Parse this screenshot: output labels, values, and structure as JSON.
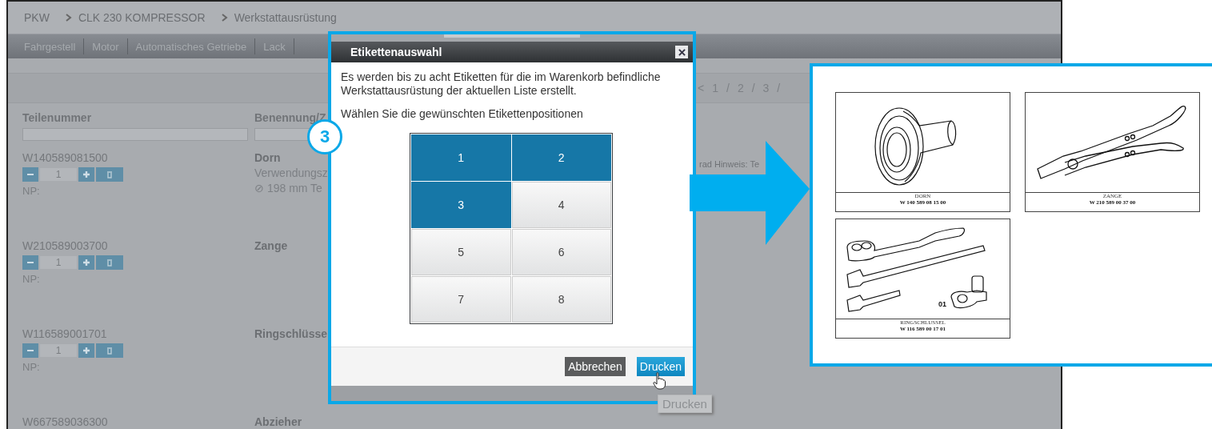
{
  "breadcrumb": [
    "PKW",
    "CLK 230 KOMPRESSOR",
    "Werkstattausrüstung"
  ],
  "tabs": [
    {
      "label": "Fahrgestell",
      "selected": false
    },
    {
      "label": "Motor",
      "selected": false
    },
    {
      "label": "Automatisches Getriebe",
      "selected": false
    },
    {
      "label": "Lack",
      "selected": false
    }
  ],
  "pagination": [
    "<",
    "1",
    "/",
    "2",
    "/",
    "3",
    "/"
  ],
  "table": {
    "columns": [
      "Teilenummer",
      "Benennung/Z"
    ],
    "rows": [
      {
        "kind": "editable",
        "part_number": "W140589081500",
        "quantity": "1",
        "np": "NP:",
        "name": "Dorn",
        "details": [
          "Verwendungsz",
          "⊘ 198 mm Te"
        ],
        "note": "rad Hinweis: Te"
      },
      {
        "kind": "editable",
        "part_number": "W210589003700",
        "quantity": "1",
        "np": "NP:",
        "name": "Zange",
        "details": []
      },
      {
        "kind": "editable",
        "part_number": "W116589001701",
        "quantity": "1",
        "np": "NP:",
        "name": "Ringschlüsse",
        "details": []
      },
      {
        "kind": "badge",
        "part_number": "W667589036300",
        "name": "Abzieher",
        "details": []
      }
    ]
  },
  "step_badge": "3",
  "dialog": {
    "title": "Etikettenauswahl",
    "intro": "Es werden bis zu acht Etiketten für die im Warenkorb befindliche Werkstattausrüstung der aktuellen Liste erstellt.",
    "prompt": "Wählen Sie die gewünschten Etikettenpositionen",
    "positions": [
      {
        "label": "1",
        "selected": true
      },
      {
        "label": "2",
        "selected": true
      },
      {
        "label": "3",
        "selected": true
      },
      {
        "label": "4",
        "selected": false
      },
      {
        "label": "5",
        "selected": false
      },
      {
        "label": "6",
        "selected": false
      },
      {
        "label": "7",
        "selected": false
      },
      {
        "label": "8",
        "selected": false
      }
    ],
    "cancel": "Abbrechen",
    "print": "Drucken"
  },
  "tooltip": "Drucken",
  "preview": {
    "labels": [
      {
        "kind": "mandrel",
        "name": "DORN",
        "number": "W 140 589 08 15 00"
      },
      {
        "kind": "pliers",
        "name": "ZANGE",
        "number": "W 210 589 00 37 00"
      },
      {
        "kind": "ratchet",
        "name": "RINGSCHLUSSEL",
        "number": "W 116 589 00 17 01",
        "callout": "01"
      }
    ]
  }
}
